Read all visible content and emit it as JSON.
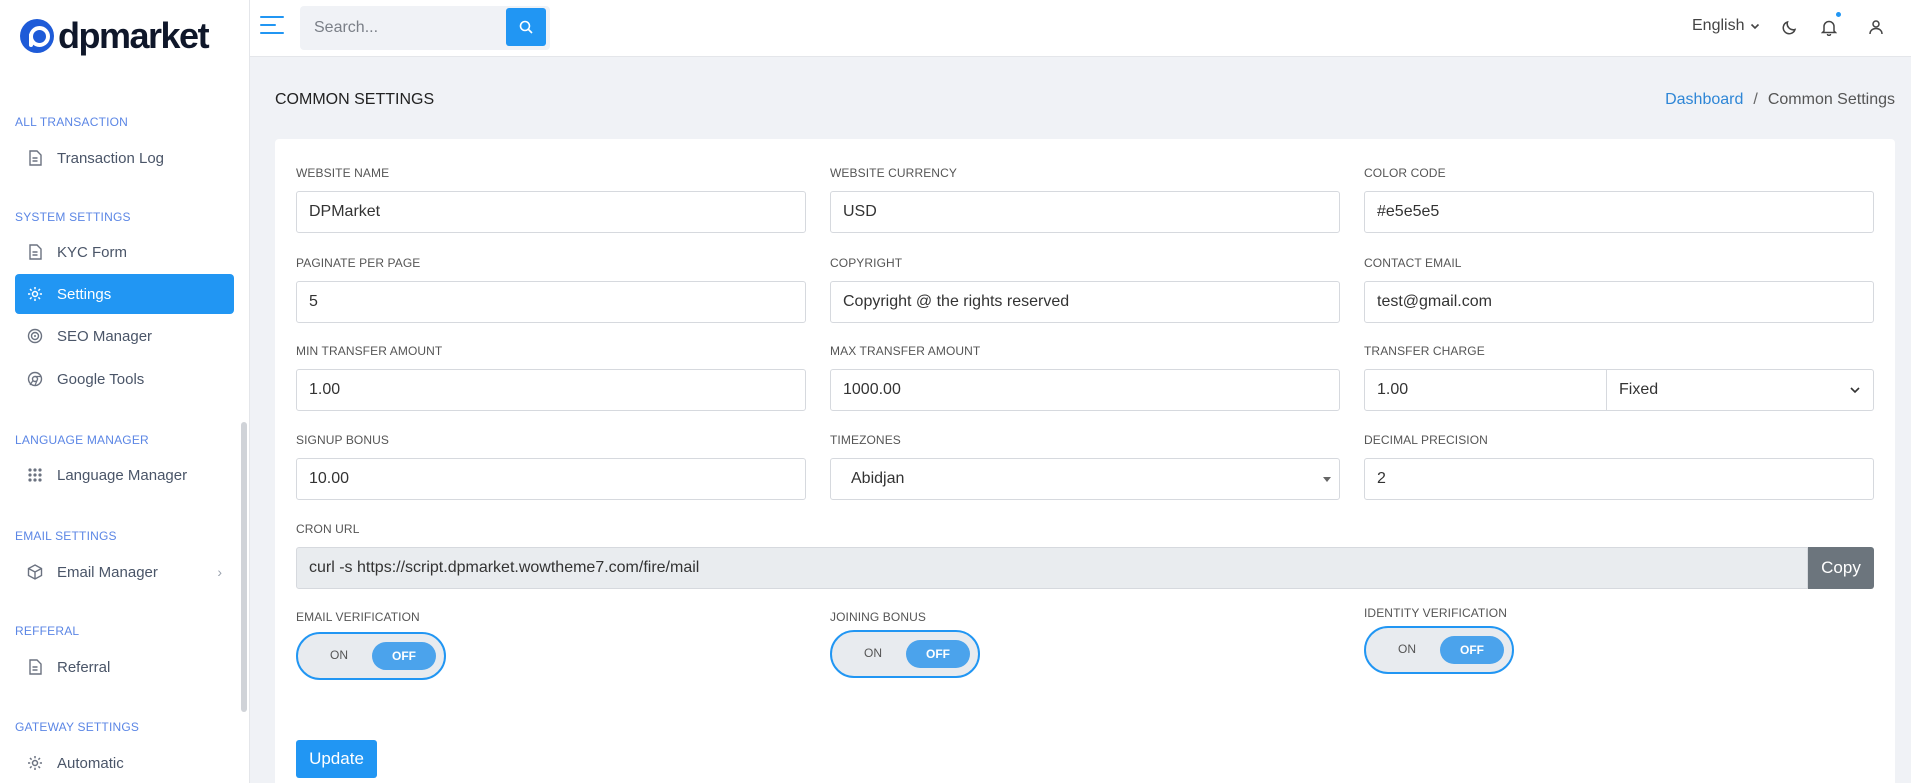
{
  "brand": {
    "name": "dpmarket"
  },
  "sidebar": {
    "sections": [
      {
        "title": "ALL TRANSACTION",
        "items": [
          {
            "label": "Transaction Log",
            "icon": "file-icon"
          }
        ]
      },
      {
        "title": "SYSTEM SETTINGS",
        "items": [
          {
            "label": "KYC Form",
            "icon": "file-icon"
          },
          {
            "label": "Settings",
            "icon": "gear-icon",
            "active": true
          },
          {
            "label": "SEO Manager",
            "icon": "target-icon"
          },
          {
            "label": "Google Tools",
            "icon": "chrome-icon"
          }
        ]
      },
      {
        "title": "LANGUAGE MANAGER",
        "items": [
          {
            "label": "Language Manager",
            "icon": "grid-icon"
          }
        ]
      },
      {
        "title": "EMAIL SETTINGS",
        "items": [
          {
            "label": "Email Manager",
            "icon": "box-icon"
          }
        ]
      },
      {
        "title": "REFFERAL",
        "items": [
          {
            "label": "Referral",
            "icon": "file-icon"
          }
        ]
      },
      {
        "title": "GATEWAY SETTINGS",
        "items": [
          {
            "label": "Automatic",
            "icon": "gear-icon"
          }
        ]
      }
    ]
  },
  "topbar": {
    "search_placeholder": "Search...",
    "language": "English"
  },
  "page": {
    "title": "COMMON SETTINGS",
    "breadcrumb": {
      "home": "Dashboard",
      "current": "Common Settings"
    }
  },
  "form": {
    "website_name": {
      "label": "WEBSITE NAME",
      "value": "DPMarket"
    },
    "website_currency": {
      "label": "WEBSITE CURRENCY",
      "value": "USD"
    },
    "color_code": {
      "label": "COLOR CODE",
      "value": "#e5e5e5"
    },
    "paginate": {
      "label": "PAGINATE PER PAGE",
      "value": "5"
    },
    "copyright": {
      "label": "COPYRIGHT",
      "value": "Copyright @ the rights reserved"
    },
    "contact_email": {
      "label": "CONTACT EMAIL",
      "value": "test@gmail.com"
    },
    "min_transfer": {
      "label": "MIN TRANSFER AMOUNT",
      "value": "1.00"
    },
    "max_transfer": {
      "label": "MAX TRANSFER AMOUNT",
      "value": "1000.00"
    },
    "transfer_charge": {
      "label": "TRANSFER CHARGE",
      "value": "1.00",
      "type": "Fixed"
    },
    "signup_bonus": {
      "label": "SIGNUP BONUS",
      "value": "10.00"
    },
    "timezones": {
      "label": "TIMEZONES",
      "value": "Abidjan"
    },
    "decimal_precision": {
      "label": "DECIMAL PRECISION",
      "value": "2"
    },
    "cron_url": {
      "label": "CRON URL",
      "value": "curl -s https://script.dpmarket.wowtheme7.com/fire/mail",
      "copy_label": "Copy"
    },
    "email_verification": {
      "label": "EMAIL VERIFICATION",
      "on": "ON",
      "off": "OFF"
    },
    "joining_bonus": {
      "label": "JOINING BONUS",
      "on": "ON",
      "off": "OFF"
    },
    "identity_verification": {
      "label": "IDENTITY VERIFICATION",
      "on": "ON",
      "off": "OFF"
    },
    "update_label": "Update"
  },
  "colors": {
    "accent": "#2196f3",
    "brand": "#1e5bd8"
  }
}
